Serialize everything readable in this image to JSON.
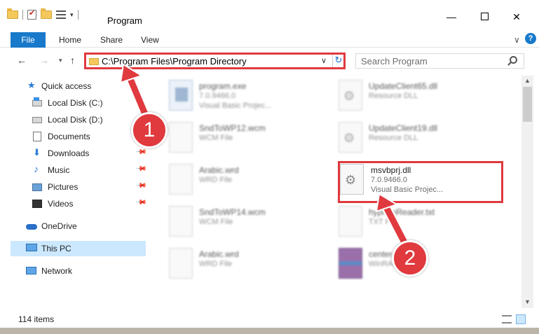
{
  "window": {
    "title": "Program",
    "minimize": "—",
    "close": "✕"
  },
  "quick_access_toolbar": {
    "customize_arrow": "▾"
  },
  "ribbon": {
    "file": "File",
    "tabs": [
      "Home",
      "Share",
      "View"
    ],
    "expand": "∨",
    "help": "?"
  },
  "nav": {
    "back": "←",
    "forward": "→",
    "recent": "▾",
    "up": "↑",
    "address": "C:\\Program Files\\Program Directory",
    "address_dropdown": "∨",
    "refresh": "↻",
    "search_placeholder": "Search Program"
  },
  "sidebar": {
    "items": [
      {
        "label": "Quick access",
        "icon": "star-icon",
        "pinned": false,
        "selected": false
      },
      {
        "label": "Local Disk (C:)",
        "icon": "disk-icon",
        "pinned": false,
        "selected": false
      },
      {
        "label": "Local Disk (D:)",
        "icon": "disk-icon",
        "pinned": false,
        "selected": false
      },
      {
        "label": "Documents",
        "icon": "documents-icon",
        "pinned": true,
        "selected": false
      },
      {
        "label": "Downloads",
        "icon": "download-icon",
        "pinned": true,
        "selected": false
      },
      {
        "label": "Music",
        "icon": "music-icon",
        "pinned": true,
        "selected": false
      },
      {
        "label": "Pictures",
        "icon": "pictures-icon",
        "pinned": true,
        "selected": false
      },
      {
        "label": "Videos",
        "icon": "videos-icon",
        "pinned": true,
        "selected": false
      },
      {
        "label": "OneDrive",
        "icon": "cloud-icon",
        "pinned": false,
        "selected": false
      },
      {
        "label": "This PC",
        "icon": "computer-icon",
        "pinned": false,
        "selected": true
      },
      {
        "label": "Network",
        "icon": "network-icon",
        "pinned": false,
        "selected": false
      }
    ]
  },
  "files": [
    {
      "name": "program.exe",
      "line2": "7.0.9466.0",
      "line3": "Visual Basic Projec...",
      "icon": "exe-icon"
    },
    {
      "name": "UpdateClient65.dll",
      "line2": "Resource DLL",
      "line3": "",
      "icon": "dll-icon"
    },
    {
      "name": "SndToWP12.wcm",
      "line2": "WCM File",
      "line3": "",
      "icon": "file-icon"
    },
    {
      "name": "UpdateClient19.dll",
      "line2": "Resource DLL",
      "line3": "",
      "icon": "dll-icon"
    },
    {
      "name": "Arabic.wrd",
      "line2": "WRD File",
      "line3": "",
      "icon": "file-icon"
    },
    {
      "name": "SndToWP14.wcm",
      "line2": "WCM File",
      "line3": "",
      "icon": "file-icon"
    },
    {
      "name": "hyphenReader.txt",
      "line2": "TXT File",
      "line3": "",
      "icon": "text-file-icon"
    },
    {
      "name": "Arabic.wrd",
      "line2": "WRD File",
      "line3": "",
      "icon": "file-icon"
    },
    {
      "name": "center-files.cab",
      "line2": "WinRAR archive",
      "line3": "",
      "icon": "archive-icon"
    }
  ],
  "highlighted_file": {
    "name": "msvbprj.dll",
    "line2": "7.0.9466.0",
    "line3": "Visual Basic Projec...",
    "icon": "dll-icon"
  },
  "status": {
    "items": "114 items"
  },
  "annotations": {
    "step1": "1",
    "step2": "2",
    "color": "#e0393e"
  },
  "colors": {
    "accent": "#1979ca",
    "selection": "#cce8ff",
    "highlight": "#e0393e"
  }
}
